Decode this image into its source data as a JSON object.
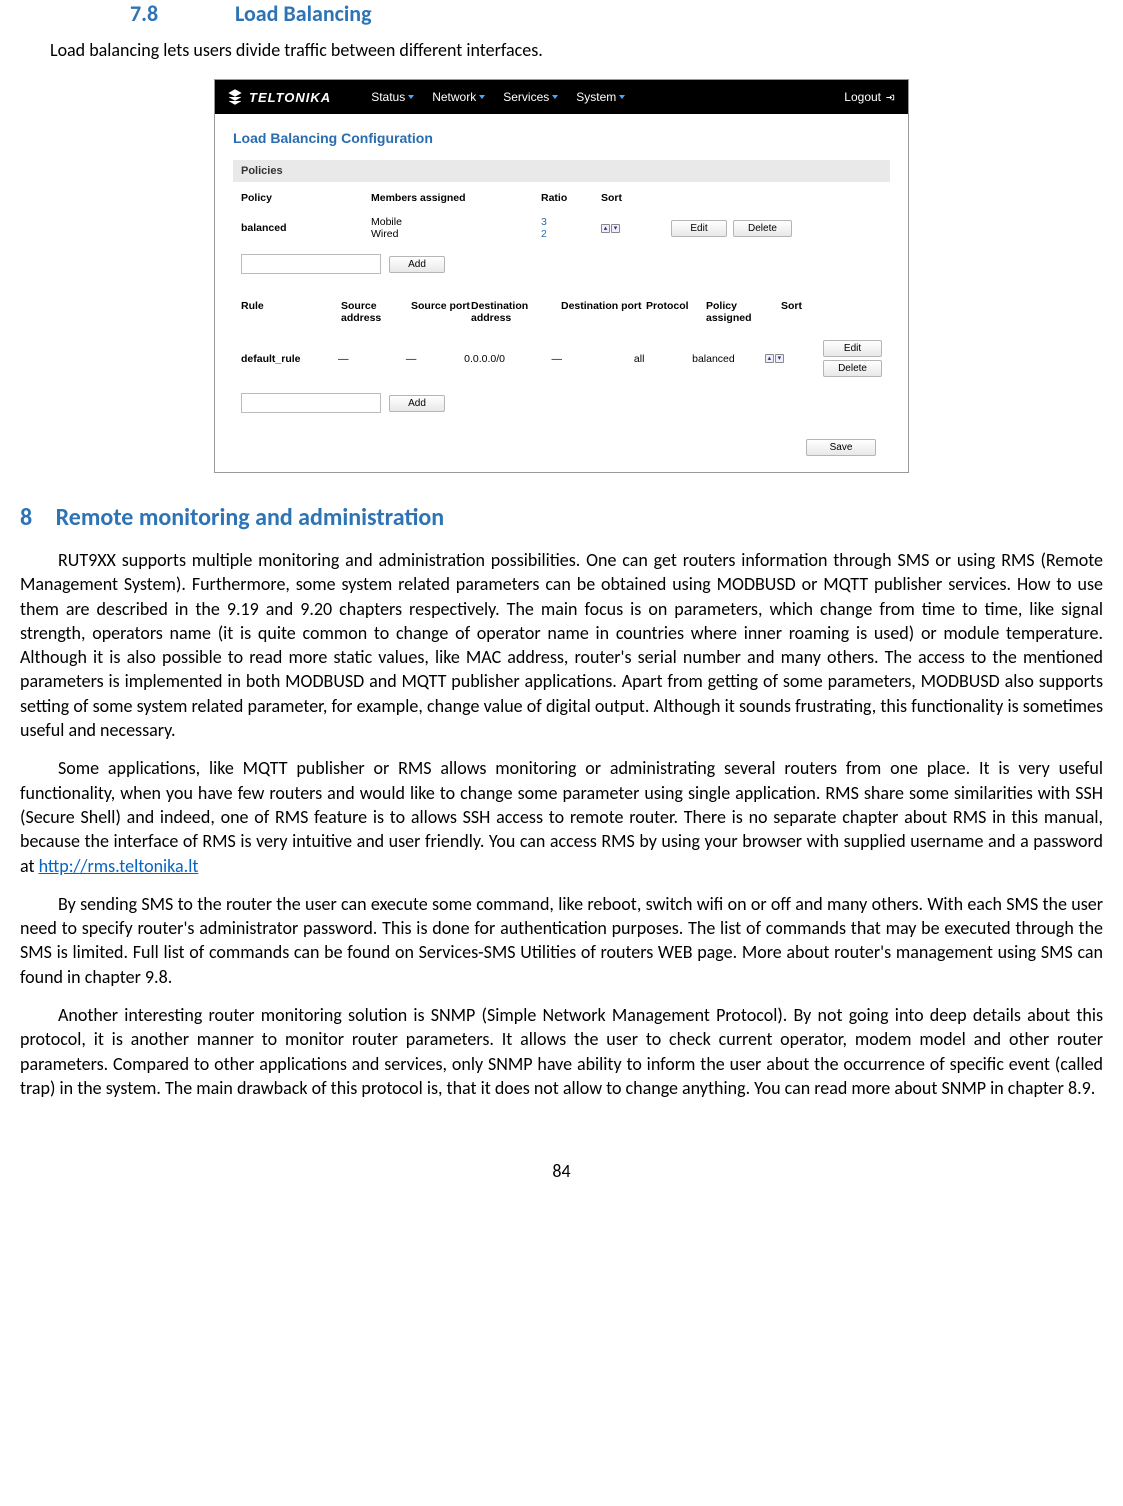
{
  "page_number": "84",
  "headings": {
    "h78_num": "7.8",
    "h78_title": "Load Balancing",
    "h8_num": "8",
    "h8_title": "Remote monitoring and administration"
  },
  "intro": "Load balancing lets users divide traffic between different interfaces.",
  "paragraphs": {
    "p1": "RUT9XX supports multiple monitoring and administration possibilities. One can get routers information through SMS or using RMS (Remote Management System). Furthermore, some system related parameters can be obtained using MODBUSD or MQTT publisher services. How to use them are described in the 9.19 and 9.20 chapters respectively. The main focus is on parameters, which change from time to time, like signal strength, operators name (it is quite common to change of operator name in countries where inner roaming is used) or module temperature. Although it is also possible to read more static values, like MAC address, router's serial number and many others. The access to the mentioned parameters is implemented in both MODBUSD and MQTT publisher applications.  Apart from getting of some parameters, MODBUSD also supports setting of some system related parameter, for example, change value of digital output. Although it sounds frustrating, this functionality is sometimes useful and necessary.",
    "p2a": "Some applications, like MQTT publisher or RMS allows monitoring or administrating several routers from one place. It is very useful functionality, when you have few routers and would like to change some parameter using single application. RMS share some similarities with SSH (Secure Shell) and indeed, one of RMS feature is to allows SSH access to remote router.  There is no separate chapter about RMS in this manual, because the interface of RMS is very intuitive and user friendly. You can access RMS by using your browser with supplied username and a password at ",
    "p2_link": "http://rms.teltonika.lt",
    "p3": "By sending SMS to the router the user can execute some command, like reboot, switch wifi on or off and many others. With each SMS the user need to specify router's administrator password. This is done for authentication purposes. The list of commands that may be executed through the SMS is limited. Full list of commands can be found on Services-SMS Utilities of routers WEB page.  More about router's management using SMS can found in chapter 9.8.",
    "p4": "Another interesting router monitoring solution is SNMP (Simple Network Management Protocol). By not going into deep details about this protocol, it is another manner to monitor router parameters. It allows the user to check current operator, modem model and other router parameters. Compared to other applications and services, only SNMP have ability to inform the user about the occurrence of specific event (called trap) in the system. The main drawback of this protocol is, that it does not allow to change anything. You can read more about SNMP in chapter 8.9."
  },
  "ui": {
    "brand": "TELTONIKA",
    "menu": {
      "status": "Status",
      "network": "Network",
      "services": "Services",
      "system": "System"
    },
    "logout": "Logout",
    "page_title": "Load Balancing Configuration",
    "policies_section": "Policies",
    "policy_cols": {
      "policy": "Policy",
      "members": "Members assigned",
      "ratio": "Ratio",
      "sort": "Sort"
    },
    "policy_row": {
      "name": "balanced",
      "member1": "Mobile",
      "member2": "Wired",
      "ratio1": "3",
      "ratio2": "2"
    },
    "rules_cols": {
      "rule": "Rule",
      "sa": "Source address",
      "sp": "Source port",
      "da": "Destination address",
      "dp": "Destination port",
      "proto": "Protocol",
      "pol": "Policy assigned",
      "sort": "Sort"
    },
    "rule_row": {
      "name": "default_rule",
      "sa": "—",
      "sp": "—",
      "da": "0.0.0.0/0",
      "dp": "—",
      "proto": "all",
      "pol": "balanced"
    },
    "buttons": {
      "edit": "Edit",
      "delete": "Delete",
      "add": "Add",
      "save": "Save"
    }
  }
}
